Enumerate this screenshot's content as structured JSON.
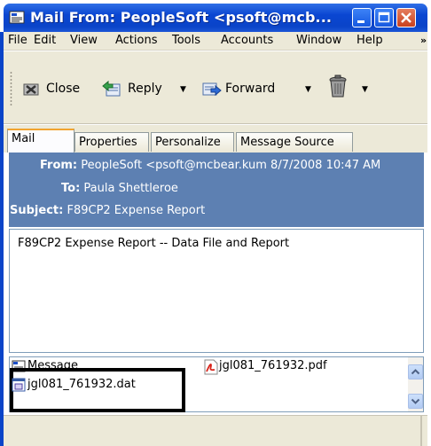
{
  "window": {
    "title": "Mail From: PeopleSoft <psoft@mcb..."
  },
  "menu": {
    "items": [
      "File",
      "Edit",
      "View",
      "Actions",
      "Tools",
      "Accounts",
      "Window",
      "Help"
    ],
    "more": "»"
  },
  "toolbar": {
    "close_label": "Close",
    "reply_label": "Reply",
    "forward_label": "Forward",
    "dropdown_glyph": "▼"
  },
  "tabs": [
    {
      "label": "Mail"
    },
    {
      "label": "Properties"
    },
    {
      "label": "Personalize"
    },
    {
      "label": "Message Source"
    }
  ],
  "header": {
    "from_label": "From:",
    "from_value": "PeopleSoft <psoft@mcbear.kum 8/7/2008 10:47 AM",
    "to_label": "To:",
    "to_value": "Paula Shettleroe",
    "subject_label": "Subject:",
    "subject_value": "F89CP2  Expense Report",
    "band_color": "#5d80b2"
  },
  "body": {
    "text": "F89CP2  Expense Report -- Data File and Report"
  },
  "attachments": {
    "message_label": "Message",
    "pdf_name": "jgl081_761932.pdf",
    "dat_name": "jgl081_761932.dat"
  }
}
